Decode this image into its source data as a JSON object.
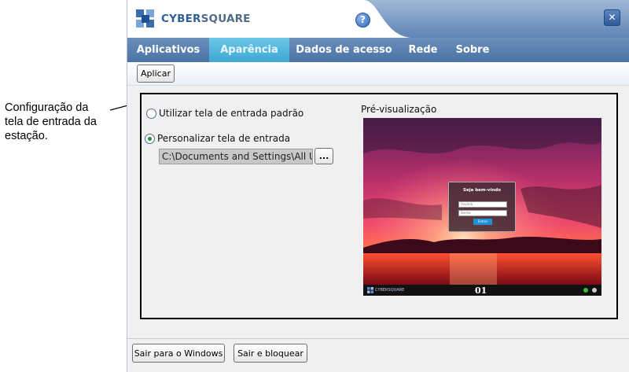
{
  "annotation": {
    "text_line1": "Configuração da",
    "text_line2": "tela de entrada da",
    "text_line3": "estação."
  },
  "header": {
    "logo_cyber": "CYBER",
    "logo_square": "SQUARE",
    "help_glyph": "?",
    "close_glyph": "✕"
  },
  "tabs": [
    {
      "label": "Aplicativos",
      "active": false
    },
    {
      "label": "Aparência",
      "active": true
    },
    {
      "label": "Dados de acesso",
      "active": false
    },
    {
      "label": "Rede",
      "active": false
    },
    {
      "label": "Sobre",
      "active": false
    }
  ],
  "toolbar": {
    "apply_label": "Aplicar"
  },
  "options": {
    "default_screen_label": "Utilizar tela de entrada padrão",
    "custom_screen_label": "Personalizar tela de entrada",
    "selected": "custom",
    "path_value": "C:\\Documents and Settings\\All Use",
    "browse_label": "..."
  },
  "preview": {
    "label": "Pré-visualização",
    "login_title": "Seja bem-vindo",
    "user_placeholder": "Usuário",
    "password_placeholder": "Senha",
    "enter_label": "Entrar",
    "footer_logo": "CYBERSQUARE",
    "station_number": "01"
  },
  "footer": {
    "exit_windows_label": "Sair para o Windows",
    "exit_lock_label": "Sair e bloquear"
  },
  "colors": {
    "tab_bar": "#4a72a6",
    "tab_active": "#3fa8d4",
    "brand": "#2f5f9a"
  }
}
